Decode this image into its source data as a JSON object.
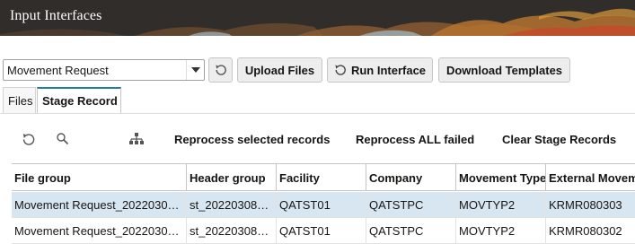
{
  "header": {
    "title": "Input Interfaces"
  },
  "toolbar": {
    "interface_select_value": "Movement Request",
    "upload_label": "Upload Files",
    "run_label": "Run Interface",
    "download_label": "Download Templates"
  },
  "tabs": [
    {
      "label": "Files",
      "active": false
    },
    {
      "label": "Stage Record",
      "active": true
    }
  ],
  "actions": {
    "reprocess_selected": "Reprocess selected records",
    "reprocess_all_failed": "Reprocess ALL failed",
    "clear_stage": "Clear Stage Records"
  },
  "table": {
    "columns": [
      "File group",
      "Header group",
      "Facility",
      "Company",
      "Movement Type",
      "External Movem"
    ],
    "rows": [
      [
        "Movement Request_2022030…",
        "st_20220308…",
        "QATST01",
        "QATSTPC",
        "MOVTYP2",
        "KRMR080303"
      ],
      [
        "Movement Request_2022030…",
        "st_20220308…",
        "QATST01",
        "QATSTPC",
        "MOVTYP2",
        "KRMR080302"
      ]
    ],
    "selected_row": 0
  },
  "colors": {
    "banner": "#312d2a",
    "selected_row": "#d8e6f2",
    "active_tab_accent": "#227e9e"
  },
  "icons": [
    "chevron-down-icon",
    "refresh-icon",
    "search-icon",
    "hierarchy-icon"
  ]
}
